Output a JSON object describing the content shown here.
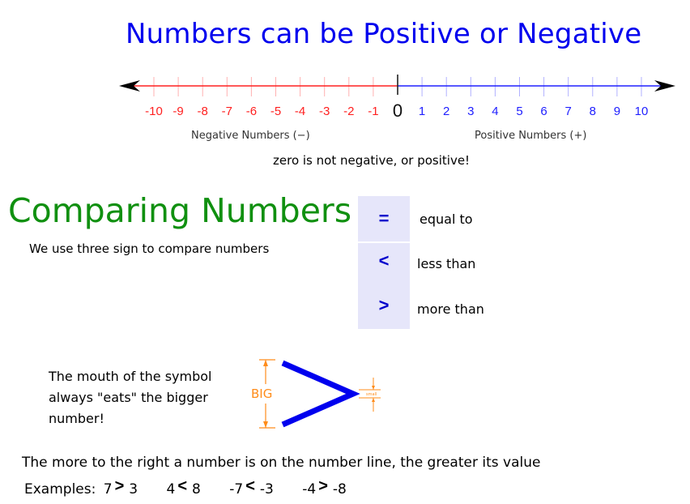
{
  "title": "Numbers can be Positive or Negative",
  "number_line": {
    "min": -10,
    "max": 10,
    "negative_ticks": [
      "-10",
      "-9",
      "-8",
      "-7",
      "-6",
      "-5",
      "-4",
      "-3",
      "-2",
      "-1"
    ],
    "zero_label": "0",
    "positive_ticks": [
      "1",
      "2",
      "3",
      "4",
      "5",
      "6",
      "7",
      "8",
      "9",
      "10"
    ],
    "negative_caption": "Negative Numbers (−)",
    "positive_caption": "Positive Numbers (+)",
    "colors": {
      "negative": "#ff2020",
      "positive": "#2020ff",
      "zero": "#222222",
      "arrow": "#000000"
    }
  },
  "zero_note": "zero is not negative, or positive!",
  "comparing": {
    "heading": "Comparing Numbers",
    "subheading": "We use three sign to compare numbers",
    "signs": [
      {
        "symbol": "=",
        "meaning": "equal to"
      },
      {
        "symbol": "<",
        "meaning": "less than"
      },
      {
        "symbol": ">",
        "meaning": "more than"
      }
    ]
  },
  "mouth_note": "The mouth of the symbol always \"eats\" the bigger number!",
  "diagram": {
    "big_label": "BIG",
    "small_label": "small",
    "accent": "#ff8c1a",
    "symbol_color": "#0000ee"
  },
  "rule": "The more to the right a number is on the number line, the greater its value",
  "examples": {
    "label": "Examples:",
    "items": [
      {
        "left": "7",
        "sign": ">",
        "right": "3"
      },
      {
        "left": "4",
        "sign": "<",
        "right": "8"
      },
      {
        "left": "-7",
        "sign": "<",
        "right": "-3"
      },
      {
        "left": "-4",
        "sign": ">",
        "right": "-8"
      }
    ]
  }
}
